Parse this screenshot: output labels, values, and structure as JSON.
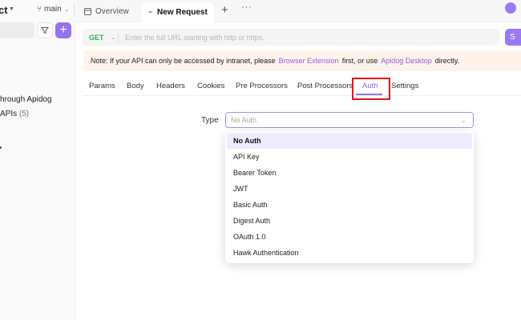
{
  "sidebar": {
    "project_title": "ct",
    "branch": "main",
    "rows": [
      {
        "text": "hrough Apidog",
        "extra": ""
      },
      {
        "text": "APIs",
        "extra": "(5)"
      }
    ]
  },
  "tabs": [
    {
      "label": "Overview",
      "icon": "overview-icon"
    },
    {
      "label": "New Request",
      "icon": "request-icon"
    }
  ],
  "url_bar": {
    "method": "GET",
    "placeholder": "Enter the full URL starting with http or https.",
    "send_label": "S"
  },
  "note": {
    "prefix": "Note: If your API can only be accessed by intranet, please",
    "link1": "Browser Extension",
    "middle": "first, or use",
    "link2": "Apidog Desktop",
    "suffix": "directly."
  },
  "request_tabs": [
    "Params",
    "Body",
    "Headers",
    "Cookies",
    "Pre Processors",
    "Post Processors",
    "Auth",
    "Settings"
  ],
  "active_request_tab": "Auth",
  "auth": {
    "type_label": "Type",
    "selected": "No Auth",
    "options": [
      "No Auth",
      "API Key",
      "Bearer Token",
      "JWT",
      "Basic Auth",
      "Digest Auth",
      "OAuth 1.0",
      "Hawk Authentication"
    ]
  },
  "colors": {
    "accent": "#9373ee",
    "get_method": "#2eaf5d",
    "note_bg": "#fdf3eb",
    "highlight": "#e3141b"
  }
}
